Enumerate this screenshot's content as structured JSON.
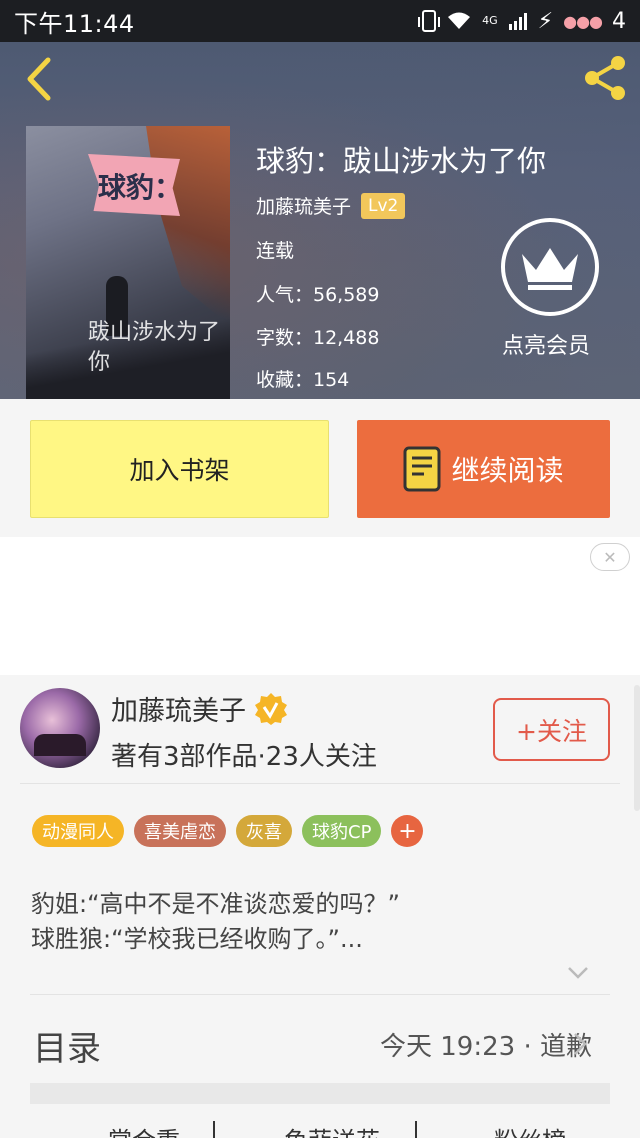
{
  "status_bar": {
    "time": "下午11:44",
    "network": "4G",
    "battery": "4"
  },
  "book": {
    "title": "球豹：跋山涉水为了你",
    "author": "加藤琉美子",
    "level": "Lv2",
    "status": "连载",
    "popularity": "人气：56,589",
    "word_count": "字数：12,488",
    "favorites": "收藏：154",
    "cover_title": "球豹：",
    "cover_subtitle": "跋山涉水为了你"
  },
  "vip": {
    "label": "点亮会员"
  },
  "actions": {
    "add_shelf": "加入书架",
    "continue_reading": "继续阅读"
  },
  "author_card": {
    "name": "加藤琉美子",
    "stats": "著有3部作品·23人关注",
    "follow": "+关注"
  },
  "tags": [
    {
      "label": "动漫同人",
      "color": "#f5b526"
    },
    {
      "label": "喜美虐恋",
      "color": "#c8725a"
    },
    {
      "label": "灰喜",
      "color": "#d4a83a"
    },
    {
      "label": "球豹CP",
      "color": "#8cc05c"
    }
  ],
  "description": {
    "line1": "豹姐:“高中不是不准谈恋爱的吗？”",
    "line2": "球胜狼:“学校我已经收购了。”..."
  },
  "toc": {
    "title": "目录",
    "latest": "今天 19:23 · 道歉"
  },
  "bottom_tabs": [
    "…掌合重",
    "…鱼菲送花",
    "…粉丝榜"
  ],
  "colors": {
    "accent_orange": "#ec6d3e",
    "shelf_yellow": "#fff784",
    "follow_red": "#e25a4a",
    "level_gold": "#f2c75b"
  },
  "icons": {
    "back": "chevron-left-icon",
    "share": "share-icon",
    "vip": "crown-icon",
    "read": "book-icon",
    "close": "close-icon",
    "verified": "verified-badge-icon",
    "expand": "chevron-down-icon",
    "toc_arrow": "chevron-right-icon"
  }
}
